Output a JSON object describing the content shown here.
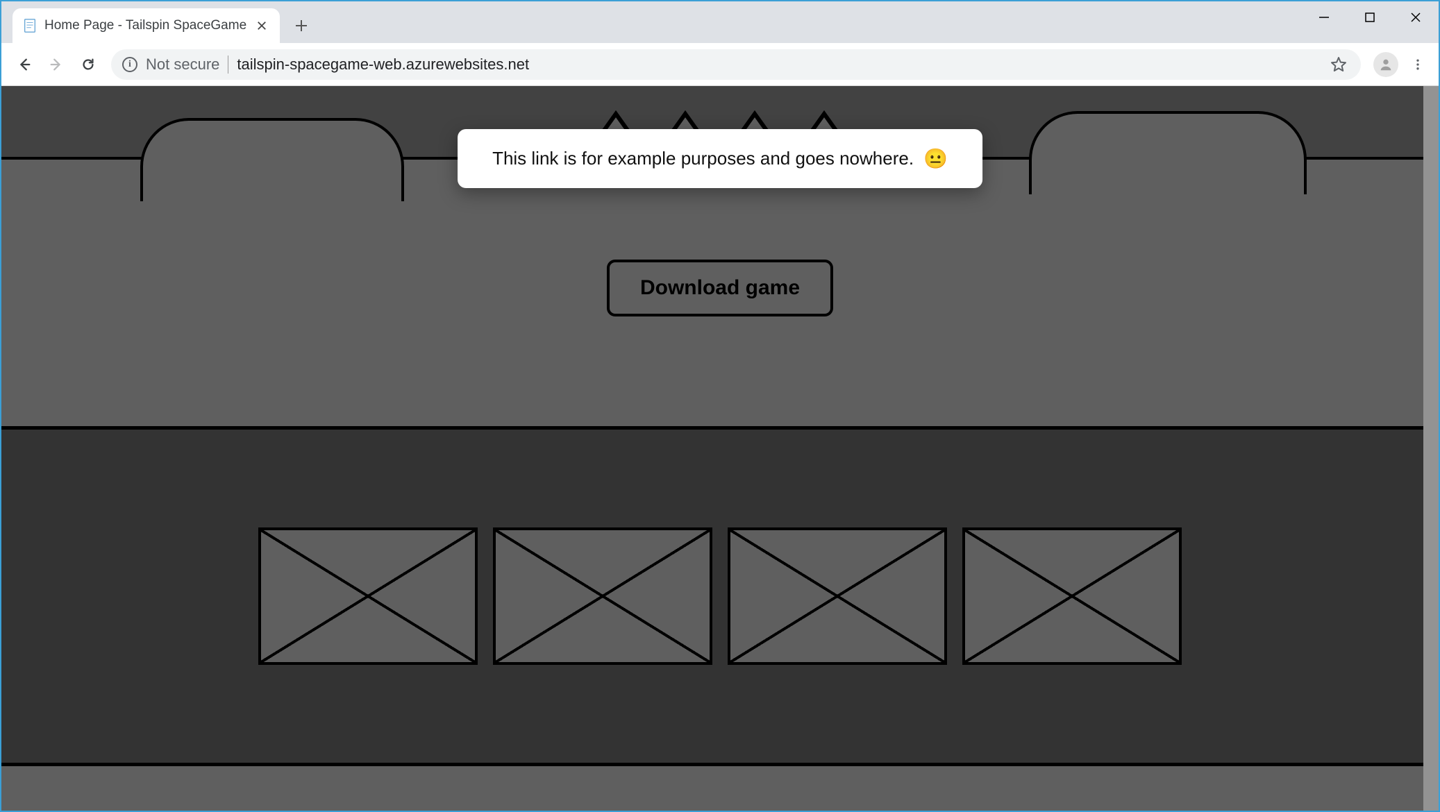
{
  "tab": {
    "title": "Home Page - Tailspin SpaceGame"
  },
  "addressbar": {
    "security_label": "Not secure",
    "url": "tailspin-spacegame-web.azurewebsites.net"
  },
  "page": {
    "download_label": "Download game"
  },
  "toast": {
    "message": "This link is for example purposes and goes nowhere.",
    "emoji": "😐"
  }
}
